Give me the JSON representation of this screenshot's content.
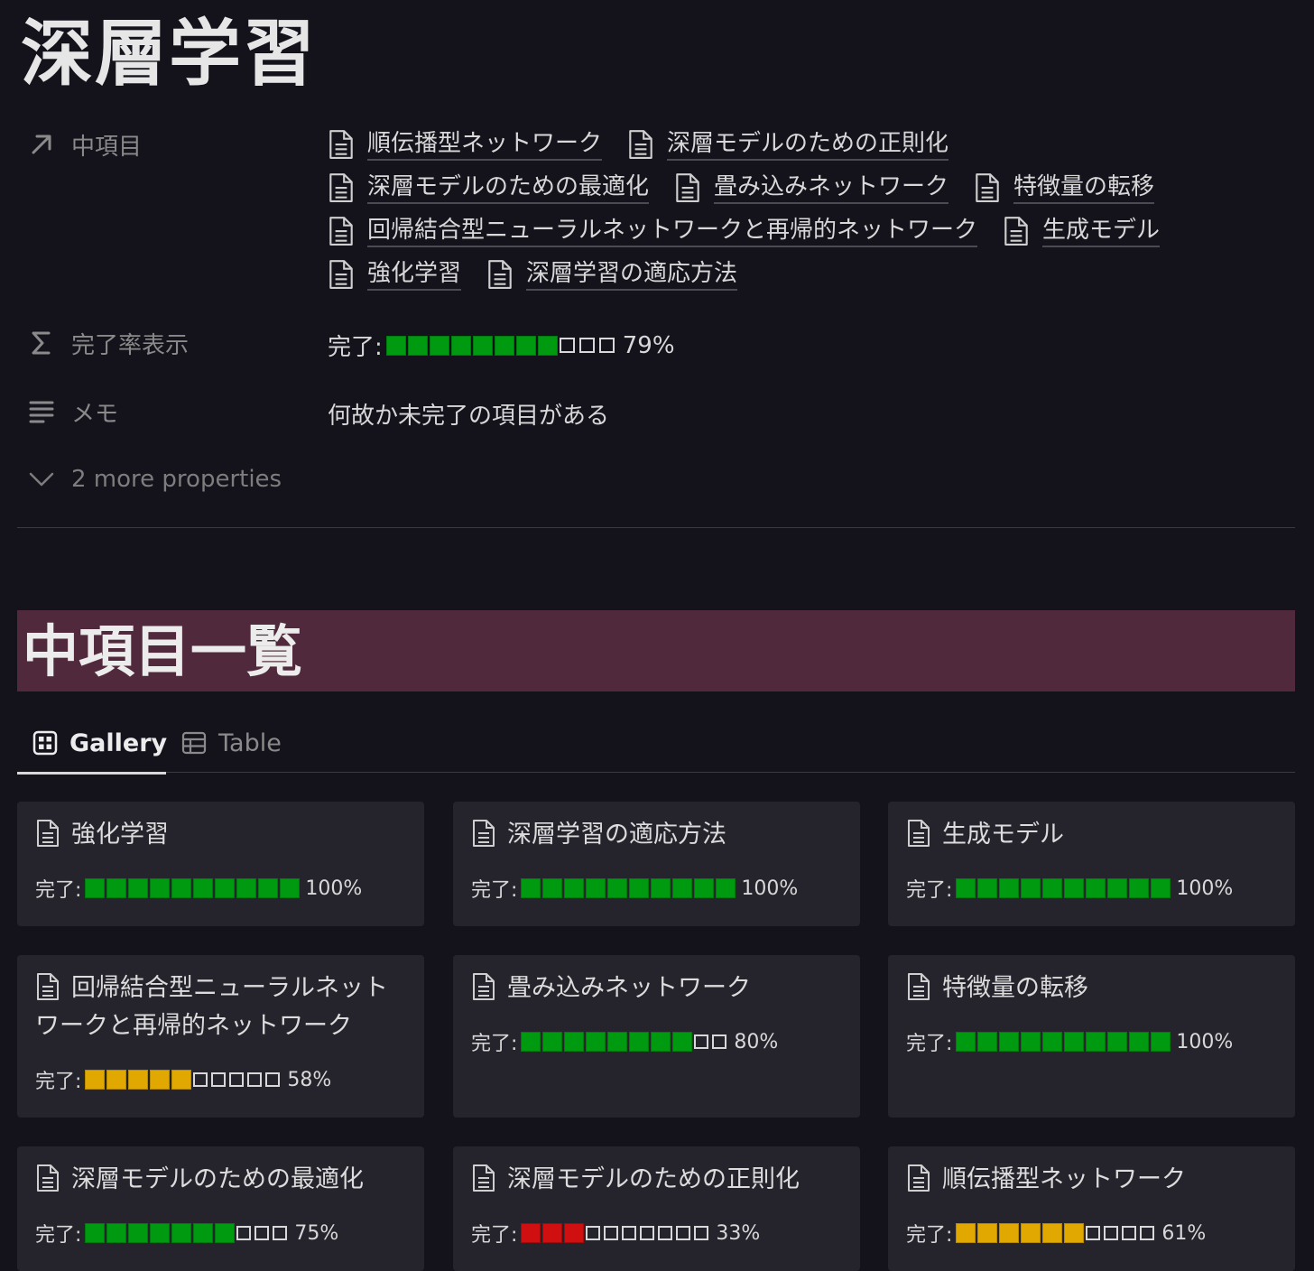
{
  "page": {
    "title": "深層学習"
  },
  "properties": {
    "relation": {
      "label": "中項目",
      "icon": "arrow-up-right-icon",
      "items": [
        "順伝播型ネットワーク",
        "深層モデルのための正則化",
        "深層モデルのための最適化",
        "畳み込みネットワーク",
        "特徴量の転移",
        "回帰結合型ニューラルネットワークと再帰的ネットワーク",
        "生成モデル",
        "強化学習",
        "深層学習の適応方法"
      ]
    },
    "completion": {
      "label": "完了率表示",
      "icon": "sigma-icon",
      "prefix": "完了:",
      "filled": 8,
      "empty": 3,
      "percent_text": "79%",
      "color": "#009a10"
    },
    "memo": {
      "label": "メモ",
      "icon": "text-lines-icon",
      "value": "何故か未完了の項目がある"
    },
    "more": {
      "label": "2 more properties"
    }
  },
  "section": {
    "heading": "中項目一覧"
  },
  "tabs": [
    {
      "label": "Gallery",
      "icon": "gallery-grid-icon",
      "active": true
    },
    {
      "label": "Table",
      "icon": "table-icon",
      "active": false
    }
  ],
  "gallery": {
    "prefix": "完了:",
    "cards": [
      {
        "title": "強化学習",
        "filled": 10,
        "empty": 0,
        "percent_text": "100%",
        "color": "green"
      },
      {
        "title": "深層学習の適応方法",
        "filled": 10,
        "empty": 0,
        "percent_text": "100%",
        "color": "green"
      },
      {
        "title": "生成モデル",
        "filled": 10,
        "empty": 0,
        "percent_text": "100%",
        "color": "green"
      },
      {
        "title": "回帰結合型ニューラルネットワークと再帰的ネットワーク",
        "filled": 5,
        "empty": 5,
        "percent_text": "58%",
        "color": "yellow"
      },
      {
        "title": "畳み込みネットワーク",
        "filled": 8,
        "empty": 2,
        "percent_text": "80%",
        "color": "green"
      },
      {
        "title": "特徴量の転移",
        "filled": 10,
        "empty": 0,
        "percent_text": "100%",
        "color": "green"
      },
      {
        "title": "深層モデルのための最適化",
        "filled": 7,
        "empty": 3,
        "percent_text": "75%",
        "color": "green"
      },
      {
        "title": "深層モデルのための正則化",
        "filled": 3,
        "empty": 7,
        "percent_text": "33%",
        "color": "red"
      },
      {
        "title": "順伝播型ネットワーク",
        "filled": 6,
        "empty": 4,
        "percent_text": "61%",
        "color": "yellow"
      }
    ]
  }
}
